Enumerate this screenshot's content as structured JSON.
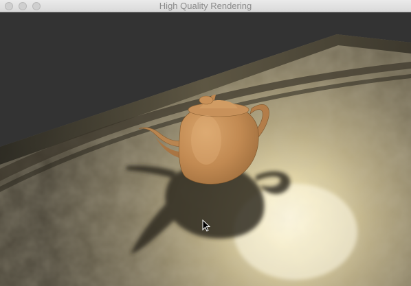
{
  "window": {
    "title": "High Quality Rendering",
    "buttons": [
      "close",
      "minimize",
      "zoom"
    ]
  },
  "scene": {
    "objects": [
      "teapot",
      "marble-floor",
      "cursor-arrow"
    ],
    "colors": {
      "background": "#333333",
      "teapot": "#c8915a",
      "floor": "#8a8068",
      "floor_highlight": "#fff6d8",
      "shadow": "#2c271c"
    }
  }
}
